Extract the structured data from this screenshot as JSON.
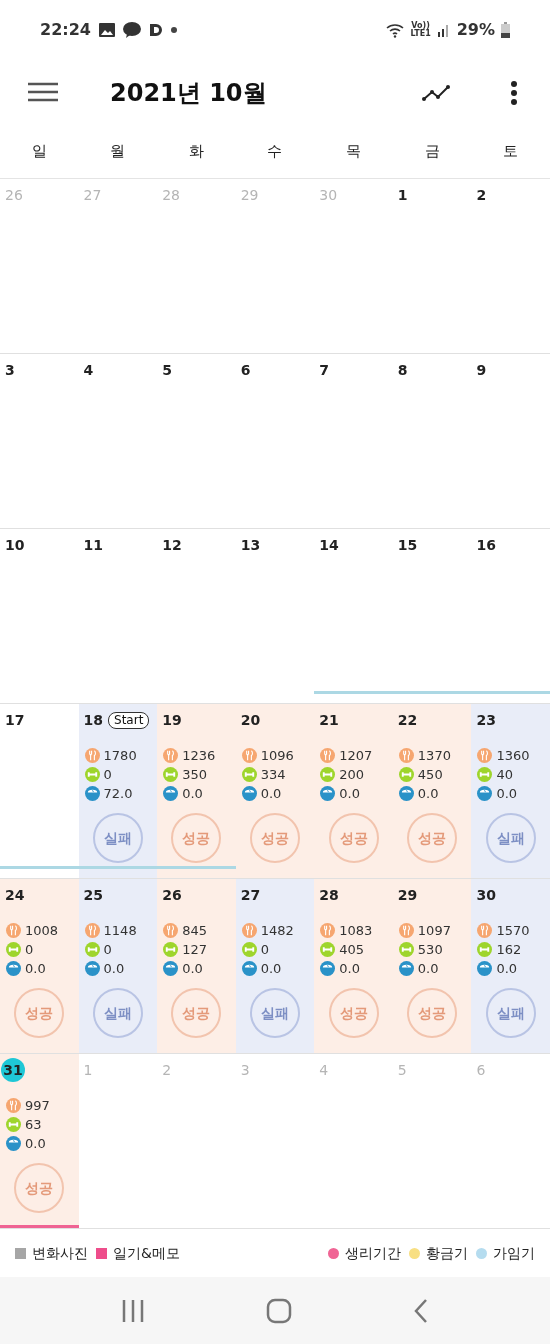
{
  "status_bar": {
    "time": "22:24",
    "network": [
      "Vo))",
      "LTE1"
    ],
    "battery": "29%"
  },
  "toolbar": {
    "title": "2021년 10월"
  },
  "weekdays": [
    "일",
    "월",
    "화",
    "수",
    "목",
    "금",
    "토"
  ],
  "weeks": [
    [
      {
        "day": "26",
        "muted": true
      },
      {
        "day": "27",
        "muted": true
      },
      {
        "day": "28",
        "muted": true
      },
      {
        "day": "29",
        "muted": true
      },
      {
        "day": "30",
        "muted": true
      },
      {
        "day": "1",
        "muted": false
      },
      {
        "day": "2",
        "muted": false
      }
    ],
    [
      {
        "day": "3",
        "muted": false
      },
      {
        "day": "4",
        "muted": false
      },
      {
        "day": "5",
        "muted": false
      },
      {
        "day": "6",
        "muted": false
      },
      {
        "day": "7",
        "muted": false
      },
      {
        "day": "8",
        "muted": false
      },
      {
        "day": "9",
        "muted": false
      }
    ],
    [
      {
        "day": "10",
        "muted": false
      },
      {
        "day": "11",
        "muted": false
      },
      {
        "day": "12",
        "muted": false
      },
      {
        "day": "13",
        "muted": false
      },
      {
        "day": "14",
        "muted": false,
        "fertile": true
      },
      {
        "day": "15",
        "muted": false,
        "fertile": true
      },
      {
        "day": "16",
        "muted": false,
        "fertile": true
      }
    ],
    [
      {
        "day": "17",
        "muted": false,
        "fertile": true
      },
      {
        "day": "18",
        "muted": false,
        "badge": "Start",
        "success": false,
        "stamp": "실패",
        "food": "1780",
        "exercise": "0",
        "weight": "72.0",
        "fertile": true
      },
      {
        "day": "19",
        "muted": false,
        "success": true,
        "stamp": "성공",
        "food": "1236",
        "exercise": "350",
        "weight": "0.0",
        "fertile": true
      },
      {
        "day": "20",
        "muted": false,
        "success": true,
        "stamp": "성공",
        "food": "1096",
        "exercise": "334",
        "weight": "0.0"
      },
      {
        "day": "21",
        "muted": false,
        "success": true,
        "stamp": "성공",
        "food": "1207",
        "exercise": "200",
        "weight": "0.0"
      },
      {
        "day": "22",
        "muted": false,
        "success": true,
        "stamp": "성공",
        "food": "1370",
        "exercise": "450",
        "weight": "0.0"
      },
      {
        "day": "23",
        "muted": false,
        "success": false,
        "stamp": "실패",
        "food": "1360",
        "exercise": "40",
        "weight": "0.0"
      }
    ],
    [
      {
        "day": "24",
        "muted": false,
        "success": true,
        "stamp": "성공",
        "food": "1008",
        "exercise": "0",
        "weight": "0.0"
      },
      {
        "day": "25",
        "muted": false,
        "success": false,
        "stamp": "실패",
        "food": "1148",
        "exercise": "0",
        "weight": "0.0"
      },
      {
        "day": "26",
        "muted": false,
        "success": true,
        "stamp": "성공",
        "food": "845",
        "exercise": "127",
        "weight": "0.0"
      },
      {
        "day": "27",
        "muted": false,
        "success": false,
        "stamp": "실패",
        "food": "1482",
        "exercise": "0",
        "weight": "0.0"
      },
      {
        "day": "28",
        "muted": false,
        "success": true,
        "stamp": "성공",
        "food": "1083",
        "exercise": "405",
        "weight": "0.0"
      },
      {
        "day": "29",
        "muted": false,
        "success": true,
        "stamp": "성공",
        "food": "1097",
        "exercise": "530",
        "weight": "0.0"
      },
      {
        "day": "30",
        "muted": false,
        "success": false,
        "stamp": "실패",
        "food": "1570",
        "exercise": "162",
        "weight": "0.0"
      }
    ],
    [
      {
        "day": "31",
        "muted": false,
        "today": true,
        "success": true,
        "stamp": "성공",
        "food": "997",
        "exercise": "63",
        "weight": "0.0",
        "menstrual": true
      },
      {
        "day": "1",
        "muted": true
      },
      {
        "day": "2",
        "muted": true
      },
      {
        "day": "3",
        "muted": true
      },
      {
        "day": "4",
        "muted": true
      },
      {
        "day": "5",
        "muted": true
      },
      {
        "day": "6",
        "muted": true
      }
    ]
  ],
  "legend_left": [
    {
      "kind": "square",
      "label": "변화사진",
      "color": "#a6a6a6"
    },
    {
      "kind": "square",
      "label": "일기&메모",
      "color": "#ee4d8b"
    }
  ],
  "legend_right": [
    {
      "kind": "dot",
      "label": "생리기간",
      "color": "#f06595"
    },
    {
      "kind": "dot",
      "label": "황금기",
      "color": "#f8df82"
    },
    {
      "kind": "dot",
      "label": "가임기",
      "color": "#b5dcef"
    }
  ]
}
